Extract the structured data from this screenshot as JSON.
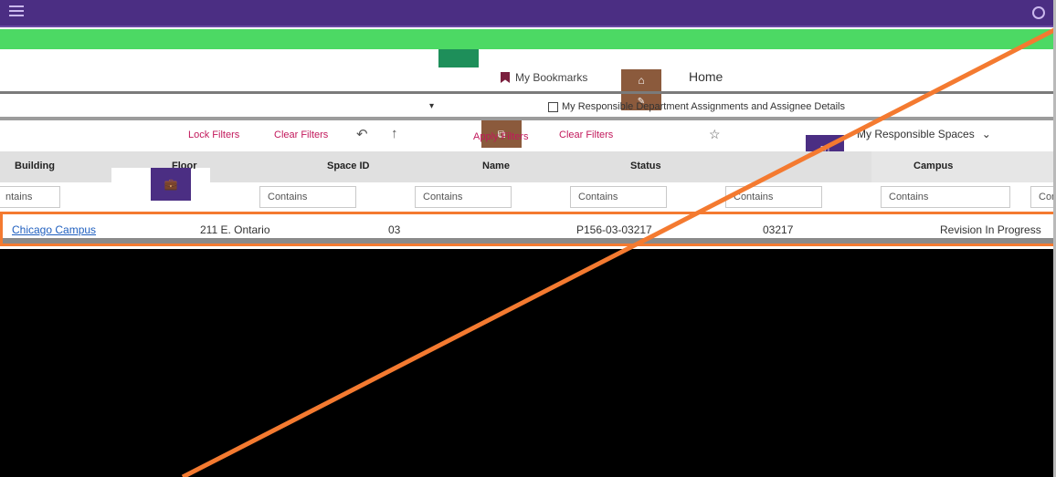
{
  "topbar": {
    "title": ""
  },
  "nav": {
    "bookmarks_label": "My Bookmarks",
    "home_label": "Home"
  },
  "tabs": {
    "dept_assignments_label": "My Responsible Department Assignments and Assignee Details"
  },
  "toolbar": {
    "lock_filters": "Lock Filters",
    "clear_filters": "Clear Filters",
    "apply_filters": "Apply Filters",
    "clear_filters_2": "Clear Filters",
    "view_name": "My Responsible Spaces"
  },
  "table": {
    "columns": [
      "Building",
      "Floor",
      "Space ID",
      "Name",
      "Status",
      "Campus"
    ],
    "filter_placeholder": "Contains",
    "filter_partial": "ntains",
    "rows": [
      {
        "campus_link": "Chicago Campus",
        "building": "211 E. Ontario",
        "floor": "03",
        "space_id": "P156-03-03217",
        "name": "03217",
        "status": "Revision In Progress"
      }
    ]
  },
  "colors": {
    "brand_purple": "#4b2e83",
    "green_band": "#4cd964",
    "accent_brown": "#8b5a3c",
    "highlight_orange": "#f47a30",
    "filter_pink": "#c2185b"
  }
}
